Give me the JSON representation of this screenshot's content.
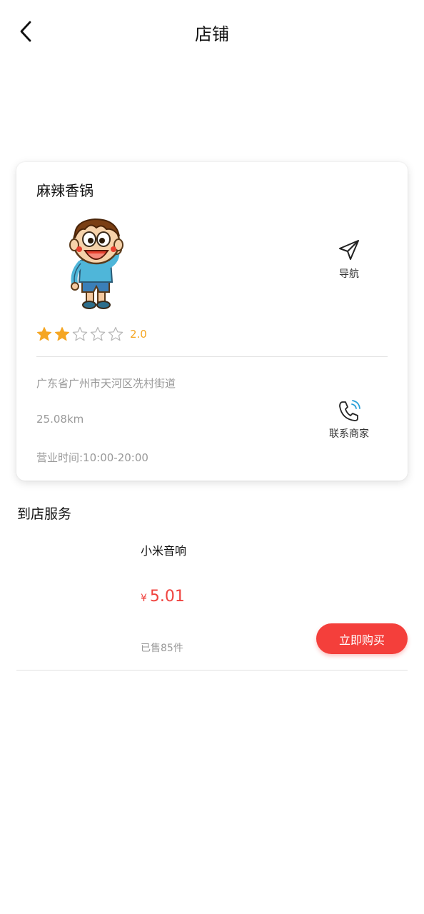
{
  "header": {
    "title": "店铺"
  },
  "shop": {
    "name": "麻辣香锅",
    "rating": 2,
    "rating_max": 5,
    "rating_text": "2.0",
    "nav_label": "导航",
    "address": "广东省广州市天河区冼村街道",
    "distance": "25.08km",
    "hours": "营业时间:10:00-20:00",
    "contact_label": "联系商家"
  },
  "section": {
    "title": "到店服务"
  },
  "product": {
    "name": "小米音响",
    "currency": "¥",
    "price": "5.01",
    "sold": "已售85件",
    "buy_label": "立即购买"
  },
  "colors": {
    "accent": "#f43f3b",
    "price": "#f0433f",
    "star": "#f5a623",
    "muted_text": "#999999"
  },
  "icons": {
    "back": "back-arrow-icon",
    "nav": "navigation-arrow-icon",
    "phone": "phone-icon",
    "star": "star-icon"
  }
}
